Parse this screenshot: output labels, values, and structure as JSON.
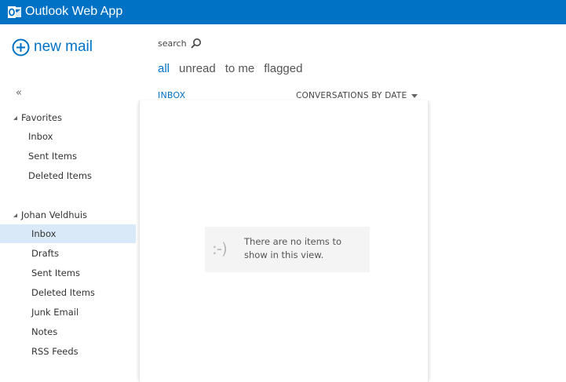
{
  "app": {
    "title": "Outlook Web App",
    "logo_icon": "outlook-logo-icon",
    "brand_color": "#0072c6"
  },
  "left_nav": {
    "new_mail_label": "new mail",
    "new_mail_icon": "plus-circle-icon",
    "collapse_label": "«",
    "favorites": {
      "header": "Favorites",
      "items": [
        {
          "label": "Inbox"
        },
        {
          "label": "Sent Items"
        },
        {
          "label": "Deleted Items"
        }
      ]
    },
    "mailbox": {
      "header": "Johan Veldhuis",
      "selected": "Inbox",
      "items": [
        {
          "label": "Inbox"
        },
        {
          "label": "Drafts"
        },
        {
          "label": "Sent Items"
        },
        {
          "label": "Deleted Items"
        },
        {
          "label": "Junk Email"
        },
        {
          "label": "Notes"
        },
        {
          "label": "RSS Feeds"
        }
      ]
    }
  },
  "search": {
    "label": "search",
    "icon": "search-icon"
  },
  "filters": [
    {
      "label": "all",
      "active": true
    },
    {
      "label": "unread",
      "active": false
    },
    {
      "label": "to me",
      "active": false
    },
    {
      "label": "flagged",
      "active": false
    }
  ],
  "list": {
    "folder_label": "INBOX",
    "sort_label": "CONVERSATIONS BY DATE",
    "empty_face": ":-)",
    "empty_message": "There are no items to show in this view."
  }
}
